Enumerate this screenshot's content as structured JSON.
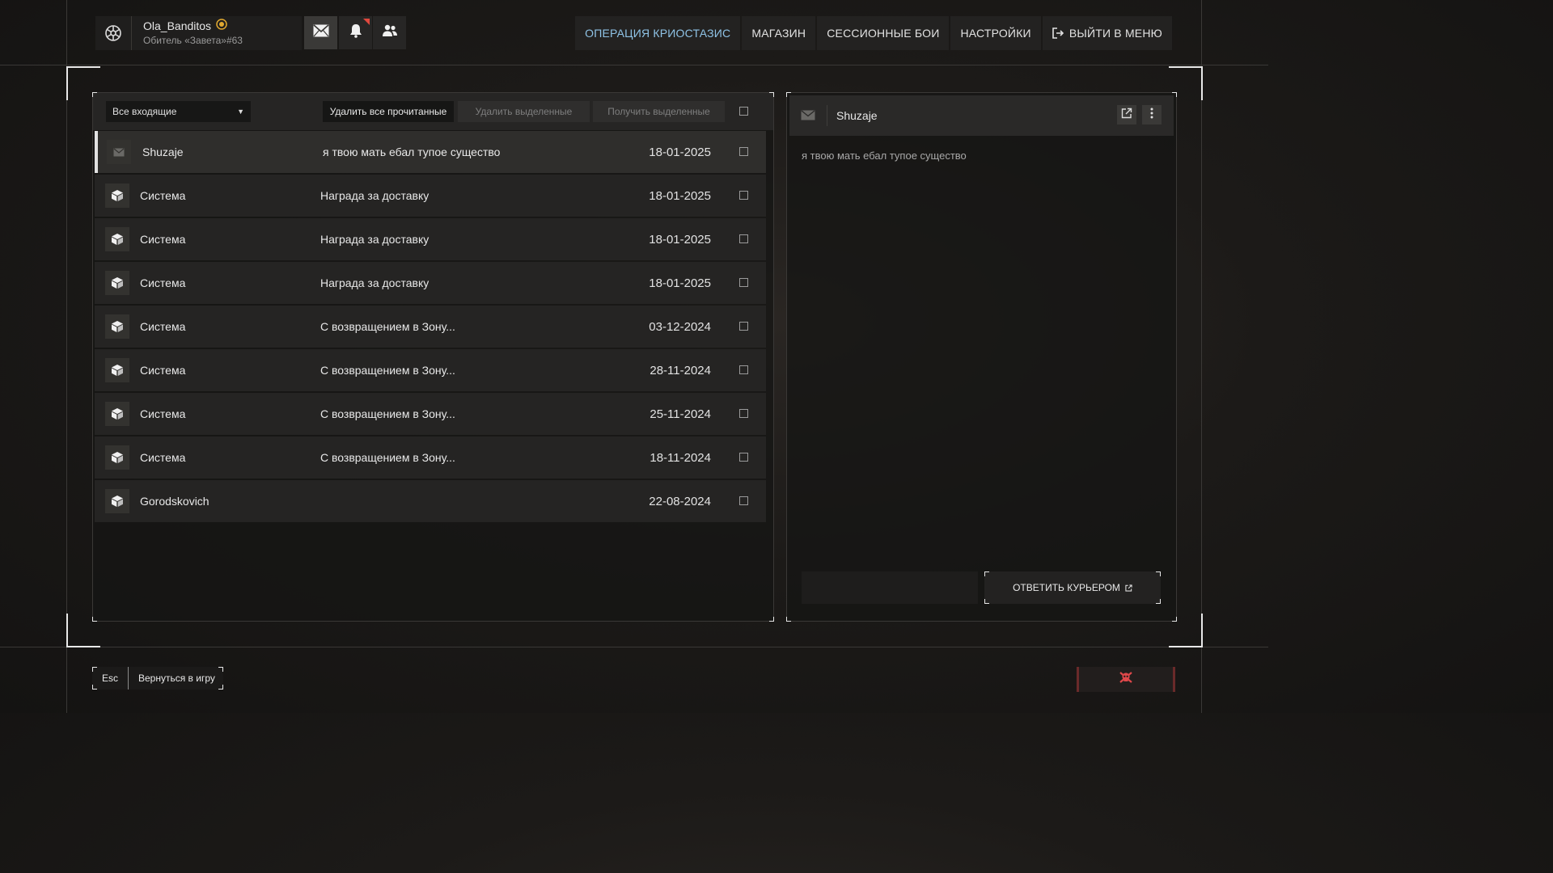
{
  "profile": {
    "username": "Ola_Banditos",
    "faction": "Обитель «Завета»#63"
  },
  "topnav": {
    "items": [
      {
        "label": "ОПЕРАЦИЯ КРИОСТАЗИС",
        "active": true
      },
      {
        "label": "МАГАЗИН"
      },
      {
        "label": "СЕССИОННЫЕ БОИ"
      },
      {
        "label": "НАСТРОЙКИ"
      },
      {
        "label": "ВЫЙТИ В МЕНЮ",
        "icon": "exit-icon"
      }
    ]
  },
  "toolbar": {
    "filter": "Все входящие",
    "delete_read": "Удалить все прочитанные",
    "delete_selected": "Удалить выделенные",
    "receive_selected": "Получить выделенные"
  },
  "messages": [
    {
      "icon": "envelope-icon",
      "sender": "Shuzaje",
      "subject": "я твою мать ебал тупое существо",
      "date": "18-01-2025",
      "selected": true
    },
    {
      "icon": "box-icon",
      "sender": "Система",
      "subject": "Награда за доставку",
      "date": "18-01-2025"
    },
    {
      "icon": "box-icon",
      "sender": "Система",
      "subject": "Награда за доставку",
      "date": "18-01-2025"
    },
    {
      "icon": "box-icon",
      "sender": "Система",
      "subject": "Награда за доставку",
      "date": "18-01-2025"
    },
    {
      "icon": "box-icon",
      "sender": "Система",
      "subject": "С возвращением в Зону...",
      "date": "03-12-2024"
    },
    {
      "icon": "box-icon",
      "sender": "Система",
      "subject": "С возвращением в Зону...",
      "date": "28-11-2024"
    },
    {
      "icon": "box-icon",
      "sender": "Система",
      "subject": "С возвращением в Зону...",
      "date": "25-11-2024"
    },
    {
      "icon": "box-icon",
      "sender": "Система",
      "subject": "С возвращением в Зону...",
      "date": "18-11-2024"
    },
    {
      "icon": "box-icon",
      "sender": "Gorodskovich",
      "subject": "",
      "date": "22-08-2024"
    }
  ],
  "reader": {
    "sender": "Shuzaje",
    "body": "я твою мать ебал тупое существо",
    "reply_button": "ОТВЕТИТЬ КУРЬЕРОМ"
  },
  "footer": {
    "esc_key": "Esc",
    "esc_label": "Вернуться в игру"
  },
  "colors": {
    "accent_active": "#8fc3e6",
    "notification": "#e0483e",
    "danger": "#e0484a"
  }
}
